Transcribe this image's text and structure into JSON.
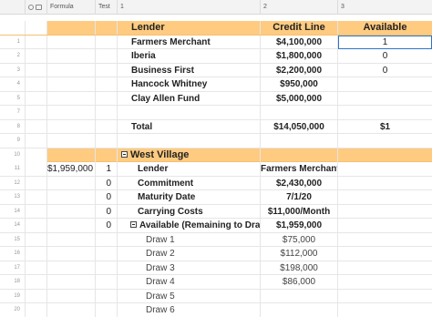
{
  "header": {
    "formula_label": "Formula",
    "test_label": "Test",
    "col1_label": "1",
    "col2_label": "2",
    "col3_label": "3"
  },
  "colors": {
    "band": "#fecb80",
    "selection": "#2e73c8",
    "header_bg": "#f3f3f3"
  },
  "rows": [
    {
      "num": "",
      "formula": "",
      "test": "",
      "c1": "Lender",
      "c2": "Credit Line",
      "c3": "Available"
    },
    {
      "num": "1",
      "formula": "",
      "test": "",
      "c1": "Farmers Merchant",
      "c2": "$4,100,000",
      "c3": "1"
    },
    {
      "num": "2",
      "formula": "",
      "test": "",
      "c1": "Iberia",
      "c2": "$1,800,000",
      "c3": "0"
    },
    {
      "num": "3",
      "formula": "",
      "test": "",
      "c1": "Business First",
      "c2": "$2,200,000",
      "c3": "0"
    },
    {
      "num": "4",
      "formula": "",
      "test": "",
      "c1": "Hancock Whitney",
      "c2": "$950,000",
      "c3": ""
    },
    {
      "num": "5",
      "formula": "",
      "test": "",
      "c1": "Clay Allen Fund",
      "c2": "$5,000,000",
      "c3": ""
    },
    {
      "num": "7",
      "formula": "",
      "test": "",
      "c1": "",
      "c2": "",
      "c3": ""
    },
    {
      "num": "8",
      "formula": "",
      "test": "",
      "c1": "Total",
      "c2": "$14,050,000",
      "c3": "$1"
    },
    {
      "num": "9",
      "formula": "",
      "test": "",
      "c1": "",
      "c2": "",
      "c3": ""
    },
    {
      "num": "10",
      "formula": "",
      "test": "",
      "c1": "West Village",
      "c2": "",
      "c3": ""
    },
    {
      "num": "11",
      "formula": "$1,959,000",
      "test": "1",
      "c1": "Lender",
      "c2": "Farmers Merchant",
      "c3": ""
    },
    {
      "num": "12",
      "formula": "",
      "test": "0",
      "c1": "Commitment",
      "c2": "$2,430,000",
      "c3": ""
    },
    {
      "num": "13",
      "formula": "",
      "test": "0",
      "c1": "Maturity Date",
      "c2": "7/1/20",
      "c3": ""
    },
    {
      "num": "14",
      "formula": "",
      "test": "0",
      "c1": "Carrying Costs",
      "c2": "$11,000/Month",
      "c3": ""
    },
    {
      "num": "14",
      "formula": "",
      "test": "0",
      "c1": "Available (Remaining to Draw)",
      "c2": "$1,959,000",
      "c3": ""
    },
    {
      "num": "15",
      "formula": "",
      "test": "",
      "c1": "Draw 1",
      "c2": "$75,000",
      "c3": ""
    },
    {
      "num": "16",
      "formula": "",
      "test": "",
      "c1": "Draw 2",
      "c2": "$112,000",
      "c3": ""
    },
    {
      "num": "17",
      "formula": "",
      "test": "",
      "c1": "Draw 3",
      "c2": "$198,000",
      "c3": ""
    },
    {
      "num": "18",
      "formula": "",
      "test": "",
      "c1": "Draw 4",
      "c2": "$86,000",
      "c3": ""
    },
    {
      "num": "19",
      "formula": "",
      "test": "",
      "c1": "Draw 5",
      "c2": "",
      "c3": ""
    },
    {
      "num": "20",
      "formula": "",
      "test": "",
      "c1": "Draw 6",
      "c2": "",
      "c3": ""
    }
  ]
}
